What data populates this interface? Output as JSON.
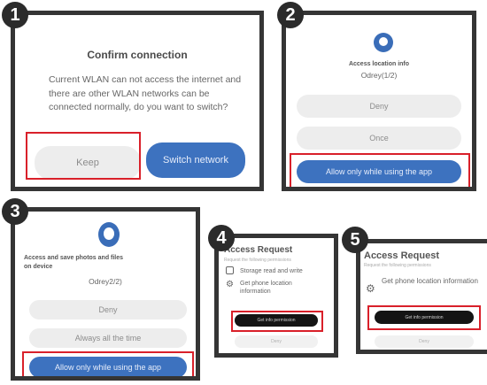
{
  "panels": [
    {
      "number": "1",
      "title": "Confirm connection",
      "body": "Current WLAN can not access the internet and there are other WLAN networks can be connected normally, do you want to switch?",
      "keep_label": "Keep",
      "switch_label": "Switch network"
    },
    {
      "number": "2",
      "title": "Access location info",
      "subtitle": "Odrey(1/2)",
      "deny_label": "Deny",
      "once_label": "Once",
      "allow_label": "Allow only while using the app"
    },
    {
      "number": "3",
      "title": "Access and save photos and files on device",
      "subtitle": "Odrey2/2)",
      "deny_label": "Deny",
      "always_label": "Always all the time",
      "allow_label": "Allow only while using the app"
    },
    {
      "number": "4",
      "title": "Access Request",
      "sub": "Request the following permissions",
      "row1": "Storage read and write",
      "row2": "Get phone location information",
      "dark_label": "Get info permission",
      "faint_label": "Deny"
    },
    {
      "number": "5",
      "title": "Access Request",
      "sub": "Request the following permissions",
      "row1": "Get phone location information",
      "dark_label": "Get info permission",
      "faint_label": "Deny"
    }
  ],
  "colors": {
    "accent_blue": "#3d72bf",
    "highlight_red": "#d9202a",
    "frame": "#353535"
  }
}
